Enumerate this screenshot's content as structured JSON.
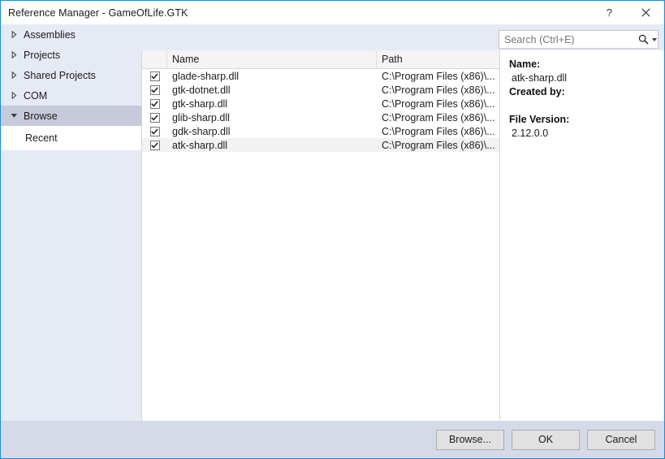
{
  "window": {
    "title": "Reference Manager - GameOfLife.GTK",
    "help_label": "?",
    "close_label": "×",
    "accent_color": "#1e8ad6",
    "sidebar_color": "#e6eaf4",
    "footer_color": "#d5dae9",
    "selection_color": "#c6cadb"
  },
  "sidebar": {
    "items": [
      {
        "label": "Assemblies",
        "expanded": false,
        "selected": false
      },
      {
        "label": "Projects",
        "expanded": false,
        "selected": false
      },
      {
        "label": "Shared Projects",
        "expanded": false,
        "selected": false
      },
      {
        "label": "COM",
        "expanded": false,
        "selected": false
      },
      {
        "label": "Browse",
        "expanded": true,
        "selected": true
      }
    ],
    "child": {
      "label": "Recent"
    }
  },
  "search": {
    "placeholder": "Search (Ctrl+E)",
    "value": "",
    "icon": "search-icon",
    "dropdown_icon": "chevron-down-icon"
  },
  "list": {
    "columns": [
      "Name",
      "Path"
    ],
    "rows": [
      {
        "checked": true,
        "name": "glade-sharp.dll",
        "path": "C:\\Program Files (x86)\\...",
        "selected": false
      },
      {
        "checked": true,
        "name": "gtk-dotnet.dll",
        "path": "C:\\Program Files (x86)\\...",
        "selected": false
      },
      {
        "checked": true,
        "name": "gtk-sharp.dll",
        "path": "C:\\Program Files (x86)\\...",
        "selected": false
      },
      {
        "checked": true,
        "name": "glib-sharp.dll",
        "path": "C:\\Program Files (x86)\\...",
        "selected": false
      },
      {
        "checked": true,
        "name": "gdk-sharp.dll",
        "path": "C:\\Program Files (x86)\\...",
        "selected": false
      },
      {
        "checked": true,
        "name": "atk-sharp.dll",
        "path": "C:\\Program Files (x86)\\...",
        "selected": true
      }
    ]
  },
  "details": {
    "name_label": "Name:",
    "name_value": "atk-sharp.dll",
    "created_by_label": "Created by:",
    "created_by_value": "",
    "file_version_label": "File Version:",
    "file_version_value": "2.12.0.0"
  },
  "footer": {
    "browse_label": "Browse...",
    "ok_label": "OK",
    "cancel_label": "Cancel"
  }
}
